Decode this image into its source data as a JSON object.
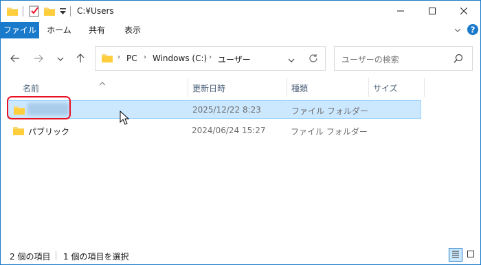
{
  "titlebar": {
    "title": "C:¥Users",
    "icons": [
      "folder-icon",
      "properties-checkmark-icon",
      "new-folder-icon",
      "customize-dropdown-icon"
    ],
    "controls": [
      "minimize-icon",
      "maximize-icon",
      "close-icon"
    ]
  },
  "ribbon": {
    "tabs": [
      {
        "label": "ファイル",
        "active": true
      },
      {
        "label": "ホーム"
      },
      {
        "label": "共有"
      },
      {
        "label": "表示"
      }
    ]
  },
  "nav": {
    "breadcrumbs": [
      "PC",
      "Windows (C:)",
      "ユーザー"
    ],
    "search_placeholder": "ユーザーの検索"
  },
  "columns": {
    "name": "名前",
    "date": "更新日時",
    "type": "種類",
    "size": "サイズ"
  },
  "files": [
    {
      "name": "",
      "date": "2025/12/22 8:23",
      "type": "ファイル フォルダー",
      "selected": true,
      "name_blurred": true
    },
    {
      "name": "パブリック",
      "date": "2024/06/24 15:27",
      "type": "ファイル フォルダー",
      "selected": false
    }
  ],
  "status": {
    "item_count": "2 個の項目",
    "selected_count": "1 個の項目を選択"
  },
  "colors": {
    "accent": "#1979ca",
    "selection_bg": "#cce8ff",
    "selection_border": "#99d1ff",
    "highlight_box": "#e81123",
    "folder": "#f8d775"
  }
}
